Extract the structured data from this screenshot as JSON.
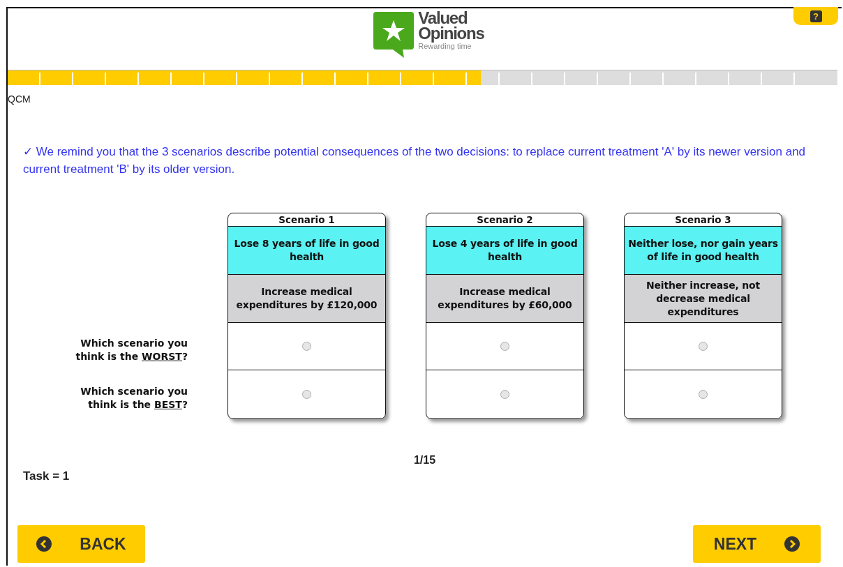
{
  "header": {
    "logo": {
      "line_1": "Valued",
      "line_2": "Opinions",
      "tagline": "Rewarding time"
    },
    "help_button": "?"
  },
  "progress": {
    "level": 0.57
  },
  "section_label": "QCM",
  "intro": "✓ We remind you that the 3 scenarios describe potential consequences of the two decisions: to replace current treatment 'A' by its newer version and current treatment 'B' by its older version.",
  "scenarios": [
    {
      "title": "Scenario 1",
      "health": "Lose 8 years of life in good health",
      "cost": "Increase medical expenditures by £120,000"
    },
    {
      "title": "Scenario 2",
      "health": "Lose 4 years of life in good health",
      "cost": "Increase medical expenditures by £60,000"
    },
    {
      "title": "Scenario 3",
      "health": "Neither lose, nor gain years of life in good health",
      "cost": "Neither increase, not decrease medical expenditures"
    }
  ],
  "questions": [
    {
      "text_before": "Which scenario you think is the ",
      "emphasis": "WORST",
      "text_after": "?",
      "choices": [
        {
          "selected": false
        },
        {
          "selected": false
        },
        {
          "selected": false
        }
      ]
    },
    {
      "text_before": "Which scenario you think is the ",
      "emphasis": "BEST",
      "text_after": "?",
      "choices": [
        {
          "selected": false
        },
        {
          "selected": false
        },
        {
          "selected": false
        }
      ]
    }
  ],
  "pager": "1/15",
  "task": "Task = 1",
  "buttons": {
    "back": "BACK",
    "next": "NEXT"
  }
}
